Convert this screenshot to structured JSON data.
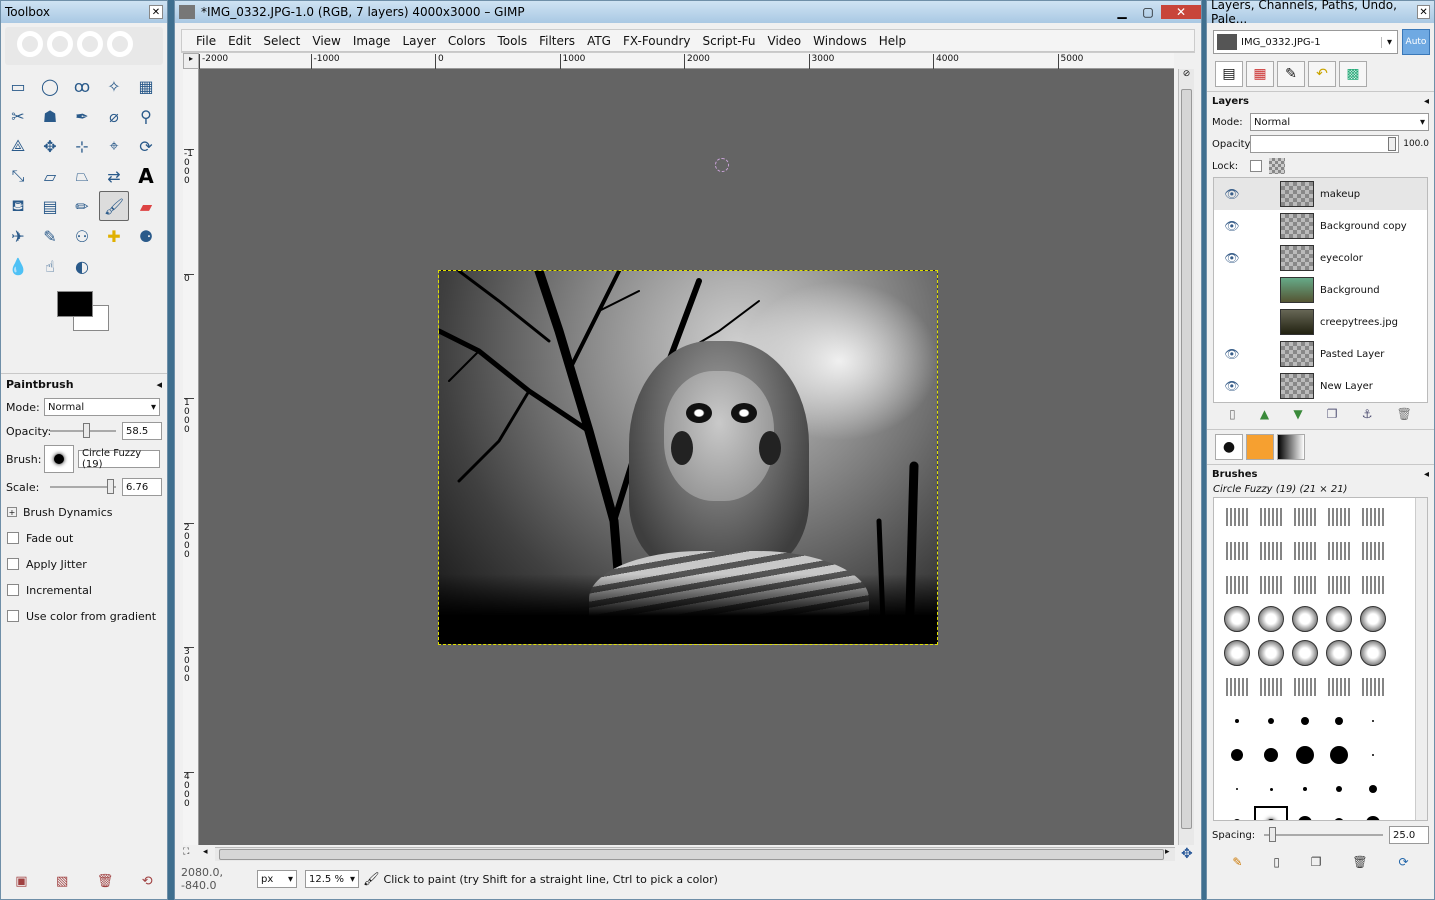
{
  "toolbox": {
    "title": "Toolbox",
    "tools": [
      "rect-select",
      "ellipse-select",
      "free-select",
      "fuzzy-select",
      "color-select",
      "scissors",
      "foreground-select",
      "paths",
      "color-picker",
      "zoom",
      "measure",
      "move",
      "align",
      "crop",
      "rotate",
      "scale",
      "shear",
      "perspective",
      "flip",
      "text",
      "bucket-fill",
      "blend",
      "pencil",
      "paintbrush",
      "eraser",
      "airbrush",
      "ink",
      "clone",
      "heal",
      "perspective-clone",
      "blur",
      "smudge",
      "dodge-burn"
    ],
    "options": {
      "title": "Paintbrush",
      "mode_label": "Mode:",
      "mode_value": "Normal",
      "opacity_label": "Opacity:",
      "opacity_value": "58.5",
      "opacity_fraction": 0.585,
      "brush_label": "Brush:",
      "brush_value": "Circle Fuzzy (19)",
      "scale_label": "Scale:",
      "scale_value": "6.76",
      "brush_dynamics": "Brush Dynamics",
      "checks": [
        "Fade out",
        "Apply Jitter",
        "Incremental",
        "Use color from gradient"
      ]
    }
  },
  "image_window": {
    "title": "*IMG_0332.JPG-1.0 (RGB, 7 layers) 4000x3000 – GIMP",
    "menu": [
      "File",
      "Edit",
      "Select",
      "View",
      "Image",
      "Layer",
      "Colors",
      "Tools",
      "Filters",
      "ATG",
      "FX-Foundry",
      "Script-Fu",
      "Video",
      "Windows",
      "Help"
    ],
    "ruler_h": [
      "-2000",
      "-1000",
      "0",
      "1000",
      "2000",
      "3000",
      "4000",
      "5000"
    ],
    "ruler_v": [
      "-1000",
      "0",
      "1000",
      "2000",
      "3000",
      "4000"
    ],
    "status": {
      "coords": "2080.0, -840.0",
      "unit": "px",
      "zoom": "12.5 %",
      "message": "Click to paint (try Shift for a straight line, Ctrl to pick a color)"
    }
  },
  "dock": {
    "title": "Layers, Channels, Paths, Undo, Pale...",
    "image_name": "IMG_0332.JPG-1",
    "auto_label": "Auto",
    "layers": {
      "title": "Layers",
      "mode_label": "Mode:",
      "mode_value": "Normal",
      "opacity_label": "Opacity:",
      "opacity_value": "100.0",
      "lock_label": "Lock:",
      "items": [
        {
          "name": "makeup",
          "visible": true
        },
        {
          "name": "Background copy",
          "visible": true
        },
        {
          "name": "eyecolor",
          "visible": true
        },
        {
          "name": "Background",
          "visible": false
        },
        {
          "name": "creepytrees.jpg",
          "visible": false
        },
        {
          "name": "Pasted Layer",
          "visible": true
        },
        {
          "name": "New Layer",
          "visible": true
        }
      ]
    },
    "brushes": {
      "title": "Brushes",
      "current": "Circle Fuzzy (19) (21 × 21)",
      "spacing_label": "Spacing:",
      "spacing_value": "25.0"
    }
  }
}
